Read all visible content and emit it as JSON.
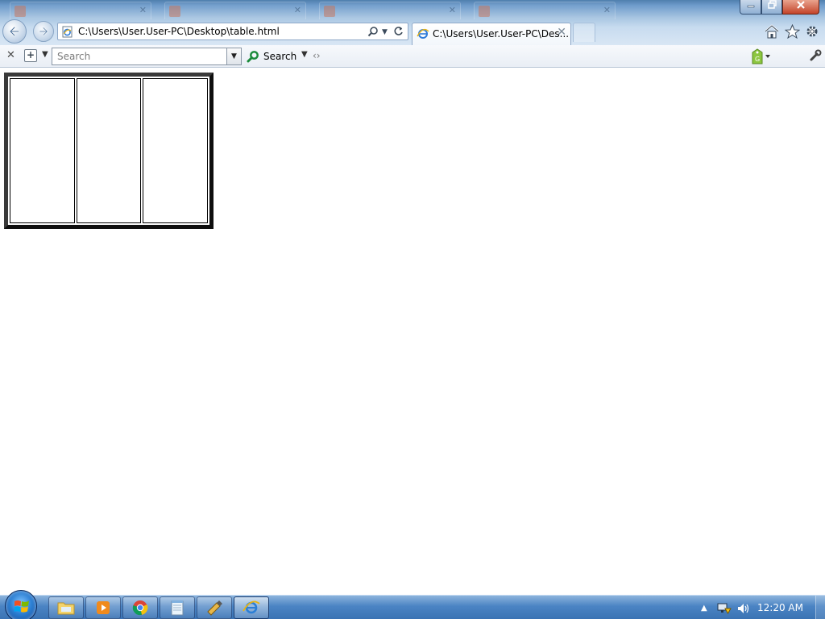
{
  "browser": {
    "address": {
      "url": "C:\\Users\\User.User-PC\\Desktop\\table.html"
    },
    "tabs": [
      {
        "title": "C:\\Users\\User.User-PC\\Des...",
        "active": true
      }
    ],
    "search": {
      "placeholder": "Search",
      "button_label": "Search"
    }
  },
  "page": {
    "table": {
      "rows": 1,
      "columns": 3,
      "cells": [
        [
          "",
          "",
          ""
        ]
      ]
    }
  },
  "taskbar": {
    "apps": [
      {
        "name": "folder-icon"
      },
      {
        "name": "media-player-icon"
      },
      {
        "name": "chrome-icon"
      },
      {
        "name": "notepad-icon"
      },
      {
        "name": "tool-app-icon"
      },
      {
        "name": "internet-explorer-icon",
        "active": true
      }
    ],
    "clock": "12:20 AM"
  },
  "colors": {
    "title_bar": "#6f9ccb",
    "taskbar": "#4b84c4",
    "table_border": "#1a1a1a",
    "close_button": "#c4442a"
  }
}
